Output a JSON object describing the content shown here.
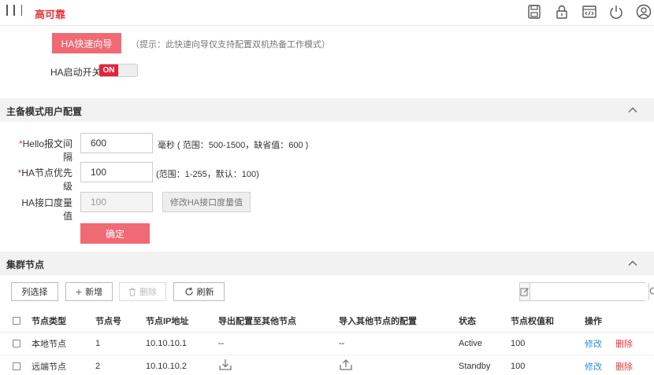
{
  "brand": "高可靠",
  "toolbar_icons": [
    "save-icon",
    "lock-icon",
    "code-icon",
    "power-icon",
    "user-icon"
  ],
  "wizard": {
    "button_label": "HA快速向导",
    "hint": "（提示：此快速向导仅支持配置双机热备工作模式）"
  },
  "ha_switch": {
    "label": "HA启动开关",
    "state": "ON"
  },
  "primary_section": {
    "title": "主备模式用户配置",
    "hello_interval": {
      "required_mark": "*",
      "label": "Hello报文间隔",
      "value": "600",
      "note": "毫秒 ( 范围：500-1500，缺省值：600 )"
    },
    "node_priority": {
      "required_mark": "*",
      "label": "HA节点优先级",
      "value": "100",
      "note": "(范围：1-255，默认：100)"
    },
    "interface_metric": {
      "label": "HA接口度量值",
      "value": "100",
      "button_label": "修改HA接口度量值"
    },
    "confirm_label": "确定"
  },
  "cluster_section": {
    "title": "集群节点",
    "buttons": {
      "column_select": "列选择",
      "add": "新增",
      "delete": "删除",
      "refresh": "刷新"
    },
    "search": {
      "value": ""
    },
    "columns": [
      "节点类型",
      "节点号",
      "节点IP地址",
      "导出配置至其他节点",
      "导入其他节点的配置",
      "状态",
      "节点权值和",
      "操作"
    ],
    "rows": [
      {
        "type": "本地节点",
        "id": "1",
        "ip": "10.10.10.1",
        "export": "--",
        "import": "--",
        "status": "Active",
        "weight": "100",
        "edit": "修改",
        "delete": "删除"
      },
      {
        "type": "远端节点",
        "id": "2",
        "ip": "10.10.10.2",
        "export": "download-icon",
        "import": "upload-icon",
        "status": "Standby",
        "weight": "100",
        "edit": "修改",
        "delete": "删除"
      }
    ]
  }
}
